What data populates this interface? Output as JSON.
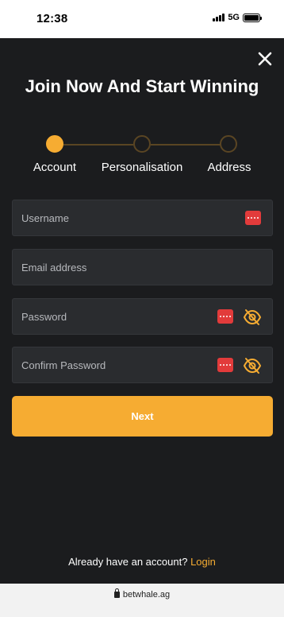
{
  "status_bar": {
    "time": "12:38",
    "network": "5G"
  },
  "modal": {
    "title": "Join Now And Start Winning",
    "steps": [
      {
        "label": "Account",
        "active": true
      },
      {
        "label": "Personalisation",
        "active": false
      },
      {
        "label": "Address",
        "active": false
      }
    ],
    "fields": {
      "username": {
        "placeholder": "Username",
        "value": ""
      },
      "email": {
        "placeholder": "Email address",
        "value": ""
      },
      "password": {
        "placeholder": "Password",
        "value": ""
      },
      "confirm_password": {
        "placeholder": "Confirm Password",
        "value": ""
      }
    },
    "next_label": "Next",
    "login_prompt": "Already have an account?",
    "login_link": "Login"
  },
  "browser": {
    "url": "betwhale.ag"
  },
  "colors": {
    "background": "#1b1c1e",
    "accent": "#f6ac32",
    "field_bg": "#2a2c2f",
    "password_manager_icon": "#e23b3b"
  },
  "icons": [
    "close-icon",
    "password-manager-icon",
    "eye-off-icon",
    "lock-icon"
  ]
}
